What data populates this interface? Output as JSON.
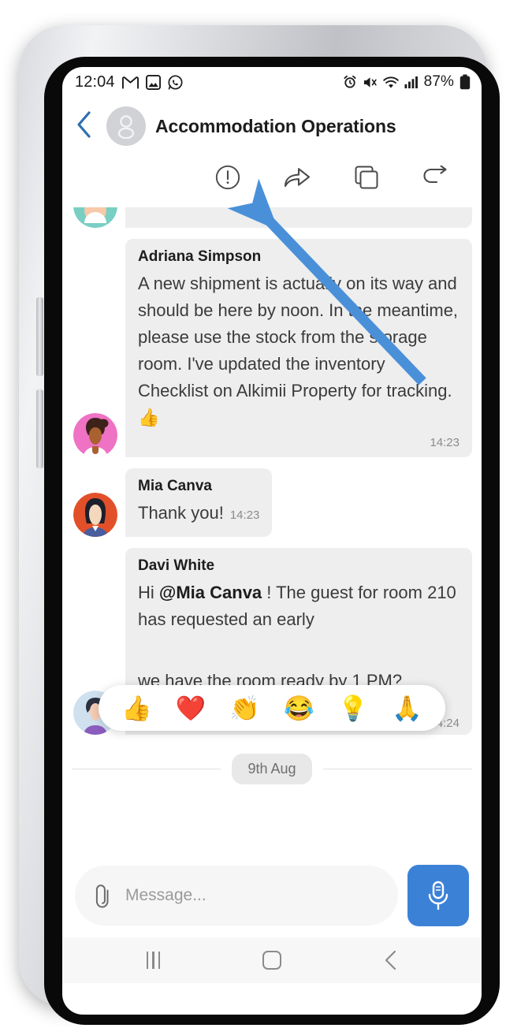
{
  "status_bar": {
    "time": "12:04",
    "left_icons": [
      "gmail-icon",
      "photos-icon",
      "whatsapp-icon"
    ],
    "right_icons": [
      "alarm-icon",
      "mute-icon",
      "wifi-icon",
      "signal-icon"
    ],
    "battery_percent": "87%"
  },
  "header": {
    "back_label": "back-chevron",
    "title": "Accommodation Operations",
    "avatar": "group-avatar"
  },
  "action_bar": {
    "items": [
      {
        "name": "info-icon",
        "label": "Info"
      },
      {
        "name": "forward-icon",
        "label": "Forward"
      },
      {
        "name": "copy-icon",
        "label": "Copy"
      },
      {
        "name": "reply-icon",
        "label": "Reply"
      }
    ]
  },
  "messages": [
    {
      "sender": "Adriana Simpson",
      "text": "A new shipment is actually on its way and should be here by noon. In the meantime, please use the stock from the storage room. I've updated the inventory Checklist on Alkimii Property for tracking. 👍",
      "time": "14:23",
      "avatar": "adriana-avatar"
    },
    {
      "sender": "Mia Canva",
      "text": "Thank you!",
      "time": "14:23",
      "avatar": "mia-avatar"
    },
    {
      "sender": "Davi White",
      "text_before_mention": "Hi ",
      "mention": "@Mia Canva",
      "text_after_mention": " ! The guest for room 210 has requested an early",
      "text_continued": "we have the room ready by 1 PM?",
      "time": "14:24",
      "avatar": "davi-avatar"
    }
  ],
  "date_divider": {
    "label": "9th Aug"
  },
  "reactions": {
    "items": [
      {
        "name": "thumbs-up-reaction",
        "emoji": "👍"
      },
      {
        "name": "heart-reaction",
        "emoji": "❤️"
      },
      {
        "name": "clap-reaction",
        "emoji": "👏"
      },
      {
        "name": "laugh-reaction",
        "emoji": "😂"
      },
      {
        "name": "bulb-reaction",
        "emoji": "💡"
      },
      {
        "name": "pray-reaction",
        "emoji": "🙏"
      }
    ]
  },
  "composer": {
    "attachment_icon": "paperclip-icon",
    "placeholder": "Message...",
    "mic_icon": "microphone-icon",
    "mic_color": "#3b82d6"
  },
  "nav_bar": {
    "recents": "recents-button",
    "home": "home-button",
    "back": "back-button"
  },
  "annotation": {
    "arrow_color": "#4a90d9",
    "name": "pointer-arrow"
  }
}
